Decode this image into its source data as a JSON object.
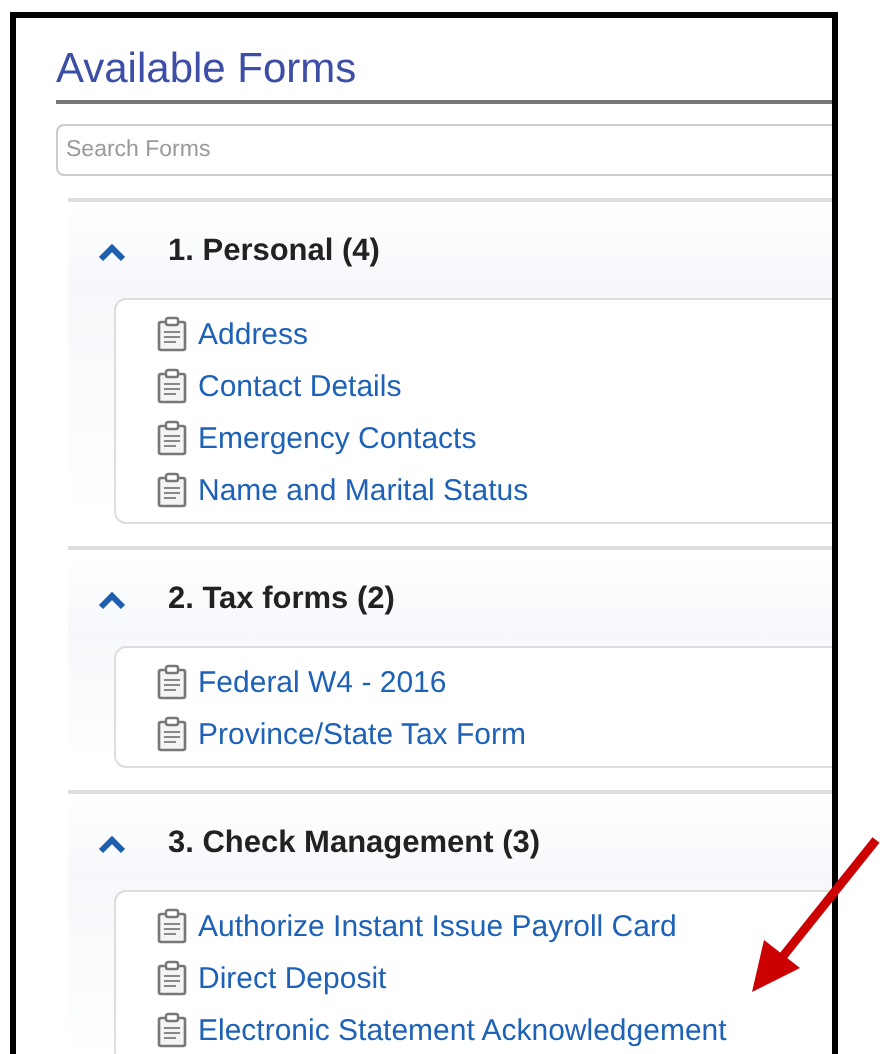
{
  "title": "Available Forms",
  "search": {
    "placeholder": "Search Forms"
  },
  "sections": [
    {
      "label": "1. Personal (4)",
      "expanded": true,
      "forms": [
        "Address",
        "Contact Details",
        "Emergency Contacts",
        "Name and Marital Status"
      ]
    },
    {
      "label": "2. Tax forms (2)",
      "expanded": true,
      "forms": [
        "Federal W4 - 2016",
        "Province/State Tax Form"
      ]
    },
    {
      "label": "3. Check Management (3)",
      "expanded": true,
      "forms": [
        "Authorize Instant Issue Payroll Card",
        "Direct Deposit",
        "Electronic Statement Acknowledgement"
      ]
    }
  ]
}
